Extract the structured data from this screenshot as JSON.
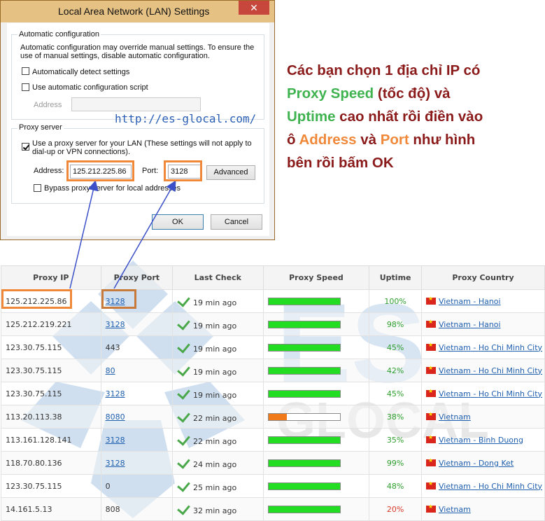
{
  "dialog": {
    "title": "Local Area Network (LAN) Settings",
    "close_label": "✕",
    "auto_config": {
      "legend": "Automatic configuration",
      "description_line1": "Automatic configuration may override manual settings.  To ensure the",
      "description_line2": "use of manual settings, disable automatic configuration.",
      "auto_detect_label": "Automatically detect settings",
      "auto_detect_checked": false,
      "script_label": "Use automatic configuration script",
      "script_checked": false,
      "address_label": "Address",
      "address_value": ""
    },
    "watermark_url": "http://es-glocal.com/",
    "proxy_server": {
      "legend": "Proxy server",
      "use_proxy_line1": "Use a proxy server for your LAN (These settings will not apply to",
      "use_proxy_line2": "dial-up or VPN connections).",
      "use_proxy_checked": true,
      "address_label": "Address:",
      "address_value": "125.212.225.86",
      "port_label": "Port:",
      "port_value": "3128",
      "advanced_label": "Advanced",
      "bypass_label": "Bypass proxy server for local addresses",
      "bypass_checked": false
    },
    "ok_label": "OK",
    "cancel_label": "Cancel"
  },
  "annotation": {
    "p1": "Các bạn chọn 1 địa chỉ IP có",
    "proxy_speed": "Proxy Speed",
    "p2": " (tốc độ) và",
    "uptime": "Uptime",
    "p3": " cao nhất rồi điền vào",
    "p4": "ô ",
    "address": "Address",
    "p5": " và ",
    "port": "Port",
    "p6": " như hình",
    "p7": "bên rồi bấm OK"
  },
  "watermark": {
    "big_text": "ES",
    "small_text": "GLOCAL"
  },
  "table": {
    "headers": [
      "Proxy IP",
      "Proxy Port",
      "Last Check",
      "Proxy Speed",
      "Uptime",
      "Proxy Country"
    ],
    "rows": [
      {
        "ip": "125.212.225.86",
        "port": "3128",
        "port_link": true,
        "last_check": "19 min ago",
        "speed": 1.0,
        "speed_color": "#22dd22",
        "uptime": "100%",
        "uptime_color": "green",
        "country": "Vietnam",
        "city": "Hanoi"
      },
      {
        "ip": "125.212.219.221",
        "port": "3128",
        "port_link": true,
        "last_check": "19 min ago",
        "speed": 1.0,
        "speed_color": "#22dd22",
        "uptime": "98%",
        "uptime_color": "green",
        "country": "Vietnam",
        "city": "Hanoi"
      },
      {
        "ip": "123.30.75.115",
        "port": "443",
        "port_link": false,
        "last_check": "19 min ago",
        "speed": 1.0,
        "speed_color": "#22dd22",
        "uptime": "45%",
        "uptime_color": "green",
        "country": "Vietnam",
        "city": "Ho Chi Minh City"
      },
      {
        "ip": "123.30.75.115",
        "port": "80",
        "port_link": true,
        "last_check": "19 min ago",
        "speed": 1.0,
        "speed_color": "#22dd22",
        "uptime": "42%",
        "uptime_color": "green",
        "country": "Vietnam",
        "city": "Ho Chi Minh City"
      },
      {
        "ip": "123.30.75.115",
        "port": "3128",
        "port_link": true,
        "last_check": "19 min ago",
        "speed": 1.0,
        "speed_color": "#22dd22",
        "uptime": "45%",
        "uptime_color": "green",
        "country": "Vietnam",
        "city": "Ho Chi Minh City"
      },
      {
        "ip": "113.20.113.38",
        "port": "8080",
        "port_link": true,
        "last_check": "22 min ago",
        "speed": 0.26,
        "speed_color": "#f07a1a",
        "uptime": "38%",
        "uptime_color": "green",
        "country": "Vietnam",
        "city": ""
      },
      {
        "ip": "113.161.128.141",
        "port": "3128",
        "port_link": true,
        "last_check": "22 min ago",
        "speed": 1.0,
        "speed_color": "#22dd22",
        "uptime": "35%",
        "uptime_color": "green",
        "country": "Vietnam",
        "city": "Binh Duong"
      },
      {
        "ip": "118.70.80.136",
        "port": "3128",
        "port_link": true,
        "last_check": "24 min ago",
        "speed": 1.0,
        "speed_color": "#22dd22",
        "uptime": "99%",
        "uptime_color": "green",
        "country": "Vietnam",
        "city": "Dong Ket"
      },
      {
        "ip": "123.30.75.115",
        "port": "0",
        "port_link": false,
        "last_check": "25 min ago",
        "speed": 1.0,
        "speed_color": "#22dd22",
        "uptime": "48%",
        "uptime_color": "green",
        "country": "Vietnam",
        "city": "Ho Chi Minh City"
      },
      {
        "ip": "14.161.5.13",
        "port": "808",
        "port_link": false,
        "last_check": "32 min ago",
        "speed": 1.0,
        "speed_color": "#22dd22",
        "uptime": "20%",
        "uptime_color": "red",
        "country": "Vietnam",
        "city": ""
      }
    ]
  },
  "colors": {
    "highlight_orange": "#f0883a",
    "arrow_blue": "#3b50c8",
    "annotation_dark_red": "#8b1a1a",
    "annotation_green": "#3fb34f"
  },
  "icons": [
    "close-icon",
    "check-icon",
    "vietnam-flag-icon",
    "arrow-icon"
  ]
}
